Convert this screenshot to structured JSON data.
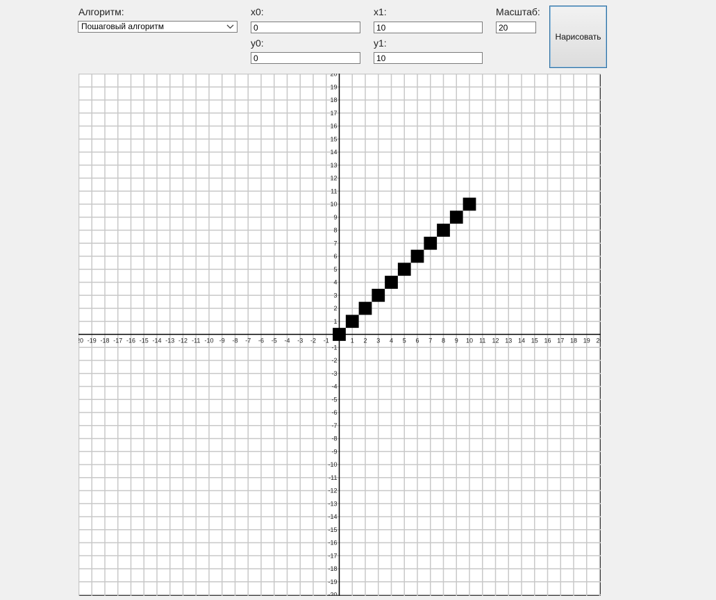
{
  "form": {
    "algorithm_label": "Алгоритм:",
    "algorithm_value": "Пошаговый алгоритм",
    "x0_label": "x0:",
    "x0_value": "0",
    "y0_label": "y0:",
    "y0_value": "0",
    "x1_label": "x1:",
    "x1_value": "10",
    "y1_label": "y1:",
    "y1_value": "10",
    "scale_label": "Масштаб:",
    "scale_value": "20",
    "draw_button": "Нарисовать"
  },
  "plot": {
    "axis_min": -20,
    "axis_max": 20,
    "grid_color": "#c8c8c8",
    "axis_color": "#000000",
    "pixel_color": "#000000",
    "line_start": [
      0,
      0
    ],
    "line_end": [
      10,
      10
    ],
    "pixels": [
      [
        0,
        0
      ],
      [
        1,
        1
      ],
      [
        2,
        2
      ],
      [
        3,
        3
      ],
      [
        4,
        4
      ],
      [
        5,
        5
      ],
      [
        6,
        6
      ],
      [
        7,
        7
      ],
      [
        8,
        8
      ],
      [
        9,
        9
      ],
      [
        10,
        10
      ]
    ]
  }
}
